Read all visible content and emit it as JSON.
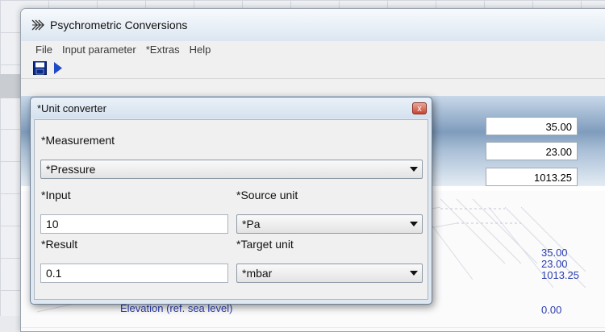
{
  "window": {
    "title": "Psychrometric Conversions"
  },
  "menu": [
    "File",
    "Input parameter",
    "*Extras",
    "Help"
  ],
  "toolbar": {
    "save_icon": "floppy-disk-icon",
    "run_icon": "play-triangle-icon",
    "accent": "#1f49c7"
  },
  "inputs_panel": {
    "values": [
      "35.00",
      "23.00",
      "1013.25"
    ]
  },
  "results_panel": {
    "values": [
      "35.00",
      "23.00",
      "1013.25"
    ],
    "elevation_label": "Elevation (ref. sea level)",
    "elevation_value": "0.00",
    "text_color": "#2a3db0"
  },
  "dialog": {
    "title": "*Unit converter",
    "close_label": "x",
    "measurement_label": "*Measurement",
    "measurement_value": "*Pressure",
    "input_label": "*Input",
    "input_value": "10",
    "source_unit_label": "*Source unit",
    "source_unit_value": "*Pa",
    "result_label": "*Result",
    "result_value": "0.1",
    "target_unit_label": "*Target unit",
    "target_unit_value": "*mbar"
  }
}
